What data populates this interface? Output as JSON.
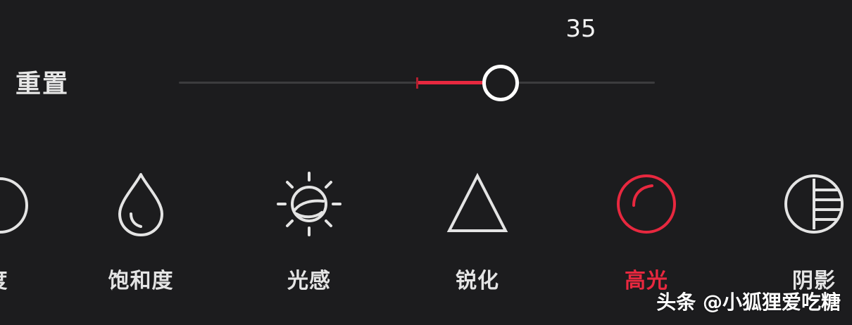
{
  "reset_label": "重置",
  "slider": {
    "value_text": "35",
    "value": 35,
    "min": -100,
    "max": 100
  },
  "tools": [
    {
      "label": "度",
      "icon": "circle-partial-icon",
      "active": false
    },
    {
      "label": "饱和度",
      "icon": "water-drop-icon",
      "active": false
    },
    {
      "label": "光感",
      "icon": "sun-icon",
      "active": false
    },
    {
      "label": "锐化",
      "icon": "triangle-icon",
      "active": false
    },
    {
      "label": "高光",
      "icon": "highlight-circle-icon",
      "active": true
    },
    {
      "label": "阴影",
      "icon": "shadow-circle-icon",
      "active": false
    }
  ],
  "watermark": "头条 @小狐狸爱吃糖",
  "colors": {
    "background": "#1c1c1e",
    "accent": "#e8283f",
    "track": "#3c3c3e",
    "text": "#e4e4e4"
  }
}
